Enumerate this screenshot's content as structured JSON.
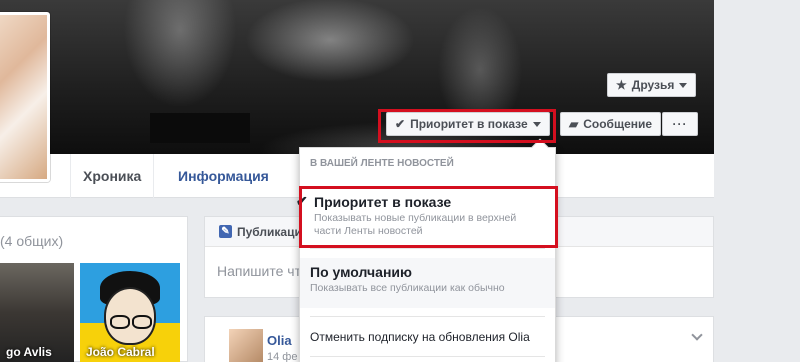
{
  "cover": {
    "buttons": {
      "friends": "Друзья",
      "priority": "Приоритет в показе",
      "message": "Сообщение",
      "more": "···"
    }
  },
  "nav": {
    "tabs": [
      {
        "label": "Хроника",
        "active": true
      },
      {
        "label": "Информация",
        "active": false
      }
    ]
  },
  "left": {
    "common_friends": "(4 общих)",
    "friends": [
      {
        "caption": "go Avlis"
      },
      {
        "caption": "João Cabral"
      }
    ]
  },
  "composer": {
    "tab": "Публикация",
    "placeholder": "Напишите чт"
  },
  "post": {
    "author": "Olia",
    "date": "14 фе"
  },
  "menu": {
    "header": "В ВАШЕЙ ЛЕНТЕ НОВОСТЕЙ",
    "options": [
      {
        "title": "Приоритет в показе",
        "desc": "Показывать новые публикации в верхней части Ленты новостей",
        "checked": true
      },
      {
        "title": "По умолчанию",
        "desc": "Показывать все публикации как обычно",
        "checked": false
      }
    ],
    "unsubscribe": "Отменить подписку на обновления Olia"
  },
  "colors": {
    "accent": "#365899",
    "highlight": "#d40f1f",
    "button_bg": "#f6f7f9"
  }
}
